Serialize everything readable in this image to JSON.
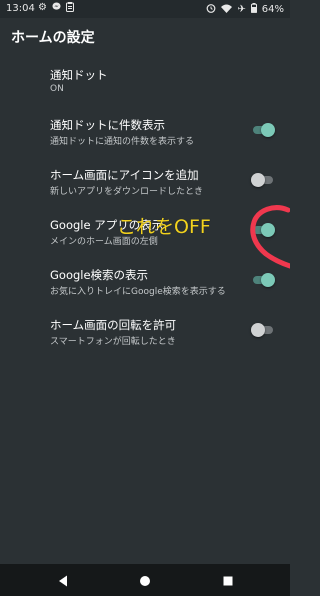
{
  "status_bar": {
    "time": "13:04",
    "battery": "64%",
    "left_icons": [
      "gear-icon",
      "messenger-icon",
      "clipboard-icon"
    ],
    "right_icons": [
      "alarm-icon",
      "wifi-icon",
      "airplane-icon",
      "battery-icon"
    ]
  },
  "appbar": {
    "title": "ホームの設定"
  },
  "settings": [
    {
      "title": "通知ドット",
      "subtitle": "ON"
    },
    {
      "title": "通知ドットに件数表示",
      "subtitle": "通知ドットに通知の件数を表示する",
      "toggle": "on"
    },
    {
      "title": "ホーム画面にアイコンを追加",
      "subtitle": "新しいアプリをダウンロードしたとき",
      "toggle": "off"
    },
    {
      "title": "Google アプリの表示",
      "subtitle": "メインのホーム画面の左側",
      "toggle": "on"
    },
    {
      "title": "Google検索の表示",
      "subtitle": "お気に入りトレイにGoogle検索を表示する",
      "toggle": "on"
    },
    {
      "title": "ホーム画面の回転を許可",
      "subtitle": "スマートフォンが回転したとき",
      "toggle": "off"
    }
  ],
  "annotation": {
    "text": "これをOFF",
    "color": "#f2d21e",
    "scribble_color": "#f0384e"
  },
  "colors": {
    "accent": "#7cc9b7",
    "background": "#2b3134",
    "nav_background": "#151819"
  }
}
